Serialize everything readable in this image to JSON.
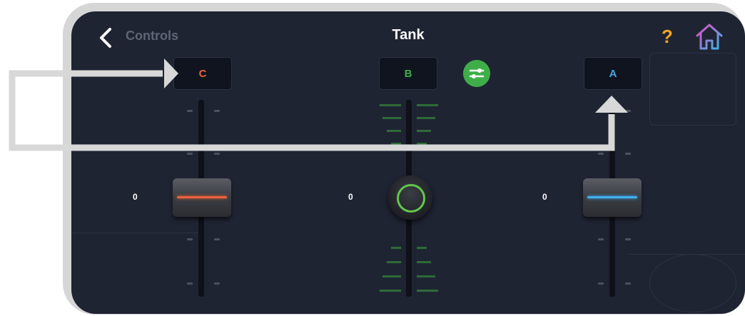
{
  "header": {
    "back_label": "Controls",
    "title": "Tank"
  },
  "ports": {
    "left": "C",
    "center": "B",
    "right": "A"
  },
  "values": {
    "left": "0",
    "center": "0",
    "right": "0"
  },
  "colors": {
    "port_c": "#e8633a",
    "port_b": "#3fae49",
    "port_a": "#4aa3e0",
    "help": "#f5a623",
    "background": "#1f2433"
  },
  "icons": {
    "back": "chevron-left-icon",
    "help": "question-mark-icon",
    "home": "home-icon",
    "settings": "sliders-icon"
  }
}
